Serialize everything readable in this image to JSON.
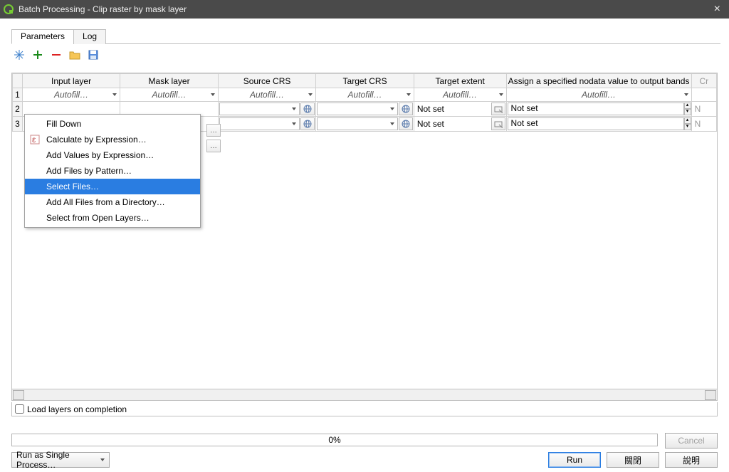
{
  "titlebar": {
    "title": "Batch Processing - Clip raster by mask layer"
  },
  "tabs": {
    "parameters": "Parameters",
    "log": "Log"
  },
  "columns": {
    "input": "Input layer",
    "mask": "Mask layer",
    "srccrs": "Source CRS",
    "tgtcrs": "Target CRS",
    "extent": "Target extent",
    "nodata": "Assign a specified nodata value to output bands",
    "last": "Cr"
  },
  "autofill": "Autofill…",
  "rows": [
    "1",
    "2",
    "3"
  ],
  "notset": "Not set",
  "n_cut": "N",
  "menu": {
    "fill_down": "Fill Down",
    "calc_expr": "Calculate by Expression…",
    "add_vals_expr": "Add Values by Expression…",
    "add_files_pattern": "Add Files by Pattern…",
    "select_files": "Select Files…",
    "add_all_dir": "Add All Files from a Directory…",
    "select_open_layers": "Select from Open Layers…"
  },
  "load_layers": "Load layers on completion",
  "progress": "0%",
  "buttons": {
    "cancel": "Cancel",
    "run": "Run",
    "close": "關閉",
    "help": "說明",
    "run_single": "Run as Single Process…"
  }
}
